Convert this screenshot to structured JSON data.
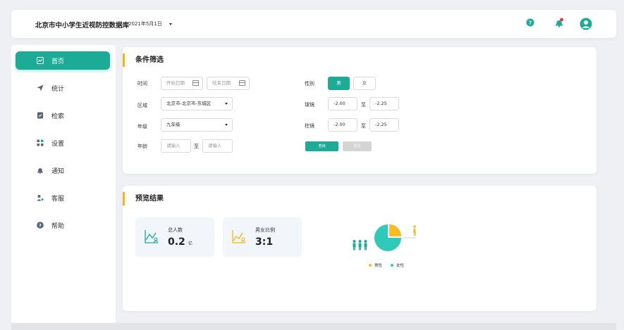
{
  "header": {
    "title": "北京市中小学生近视防控数据库",
    "date": "2021年5月1日",
    "icons": [
      "help-icon",
      "notification-icon",
      "user-avatar-icon"
    ],
    "notification_badge_color": "#e63b3b"
  },
  "sidebar": {
    "items": [
      {
        "label": "首页",
        "icon": "chart-icon",
        "active": true
      },
      {
        "label": "统计",
        "icon": "send-icon",
        "active": false
      },
      {
        "label": "检索",
        "icon": "search-doc-icon",
        "active": false
      },
      {
        "label": "设置",
        "icon": "settings-grid-icon",
        "active": false
      },
      {
        "label": "通知",
        "icon": "bell-icon",
        "active": false
      },
      {
        "label": "客服",
        "icon": "service-icon",
        "active": false
      },
      {
        "label": "帮助",
        "icon": "help-icon",
        "active": false
      }
    ]
  },
  "filter": {
    "title": "条件筛选",
    "time_label": "时间",
    "start_placeholder": "开始日期",
    "end_placeholder": "结束日期",
    "region_label": "区域",
    "region_value": "北京市-北京市-东城区",
    "grade_label": "年级",
    "grade_value": "九年级",
    "age_label": "年龄",
    "age_min_placeholder": "请输入",
    "age_to": "至",
    "age_max_placeholder": "请输入",
    "gender_label": "性别",
    "gender_male": "男",
    "gender_female": "女",
    "sphere_label": "球镜",
    "sphere_min": "-2.00",
    "sphere_to": "至",
    "sphere_max": "-2.25",
    "cylinder_label": "柱镜",
    "cylinder_min": "-2.00",
    "cylinder_to": "至",
    "cylinder_max": "-2.25",
    "query_button": "查询",
    "reset_button": "重置"
  },
  "result": {
    "title": "预览结果",
    "total_label": "总人数",
    "total_value": "0.2",
    "total_unit": "亿",
    "ratio_label": "男女比例",
    "ratio_value": "3:1",
    "legend_male": "男性",
    "legend_female": "女性"
  },
  "chart_data": {
    "type": "pie",
    "categories": [
      "男性",
      "女性"
    ],
    "values": [
      1,
      3
    ],
    "colors": [
      "#f5bd1f",
      "#2ec9b8"
    ],
    "legend_position": "bottom"
  },
  "colors": {
    "accent": "#1bab96",
    "highlight": "#f5b619"
  }
}
